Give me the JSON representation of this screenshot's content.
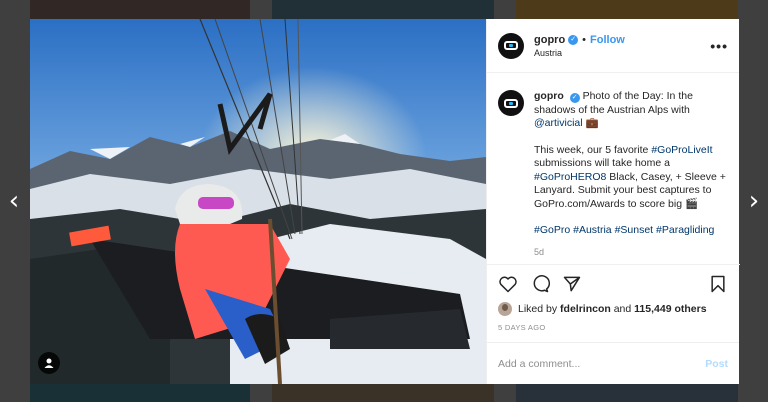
{
  "post": {
    "username": "gopro",
    "follow_label": "Follow",
    "location": "Austria",
    "more_label": "•••",
    "caption": {
      "line1_text": "Photo of the Day: In the shadows of the Austrian Alps with",
      "mention": "@artivicial",
      "para2_text": "This week, our 5 favorite",
      "tag_golive": "#GoProLiveIt",
      "para2_mid": "submissions will take home a",
      "tag_hero8": "#GoProHERO8",
      "para2_end": "Black, Casey, + Sleeve + Lanyard. Submit your best captures to GoPro.com/Awards to score big",
      "tags": [
        "#GoPro",
        "#Austria",
        "#Sunset",
        "#Paragliding"
      ],
      "age": "5d"
    },
    "liked_by_prefix": "Liked by",
    "liked_by_user": "fdelrincon",
    "liked_by_and": "and",
    "likes_count": "115,449 others",
    "date": "5 DAYS AGO",
    "comment_placeholder": "Add a comment...",
    "post_label": "Post"
  },
  "nav": {
    "prev": "‹",
    "next": "›"
  },
  "colors": {
    "link": "#3897f0",
    "hashtag": "#00376b",
    "muted": "#8e8e8e"
  }
}
